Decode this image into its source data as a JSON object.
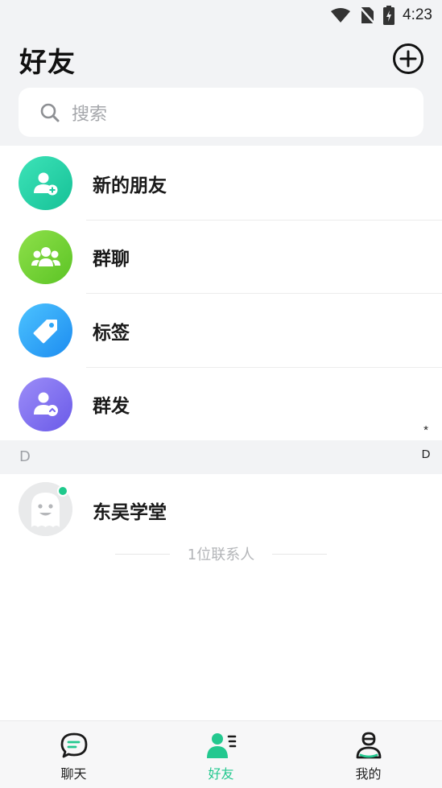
{
  "status_bar": {
    "time": "4:23",
    "icons": [
      "wifi-icon",
      "no-sim-icon",
      "battery-charging-icon"
    ]
  },
  "header": {
    "title": "好友",
    "add_icon": "plus-circle-icon"
  },
  "search": {
    "placeholder": "搜索",
    "icon": "search-icon"
  },
  "menu": {
    "items": [
      {
        "label": "新的朋友",
        "icon": "add-user-icon",
        "color": "#22d3a5"
      },
      {
        "label": "群聊",
        "icon": "group-icon",
        "color": "#6fd233"
      },
      {
        "label": "标签",
        "icon": "tag-icon",
        "color": "#2a9ff5"
      },
      {
        "label": "群发",
        "icon": "broadcast-icon",
        "color": "#7a6bf0"
      }
    ]
  },
  "index_bar": {
    "items": [
      "*",
      "D"
    ]
  },
  "sections": [
    {
      "letter": "D",
      "contacts": [
        {
          "name": "东吴学堂",
          "online": true,
          "avatar": "ghost-avatar-icon"
        }
      ]
    }
  ],
  "contact_count": "1位联系人",
  "tabs": [
    {
      "label": "聊天",
      "icon": "chat-icon",
      "active": false
    },
    {
      "label": "好友",
      "icon": "friends-icon",
      "active": true
    },
    {
      "label": "我的",
      "icon": "profile-icon",
      "active": false
    }
  ],
  "colors": {
    "accent": "#23c88f",
    "background": "#f2f3f5"
  }
}
